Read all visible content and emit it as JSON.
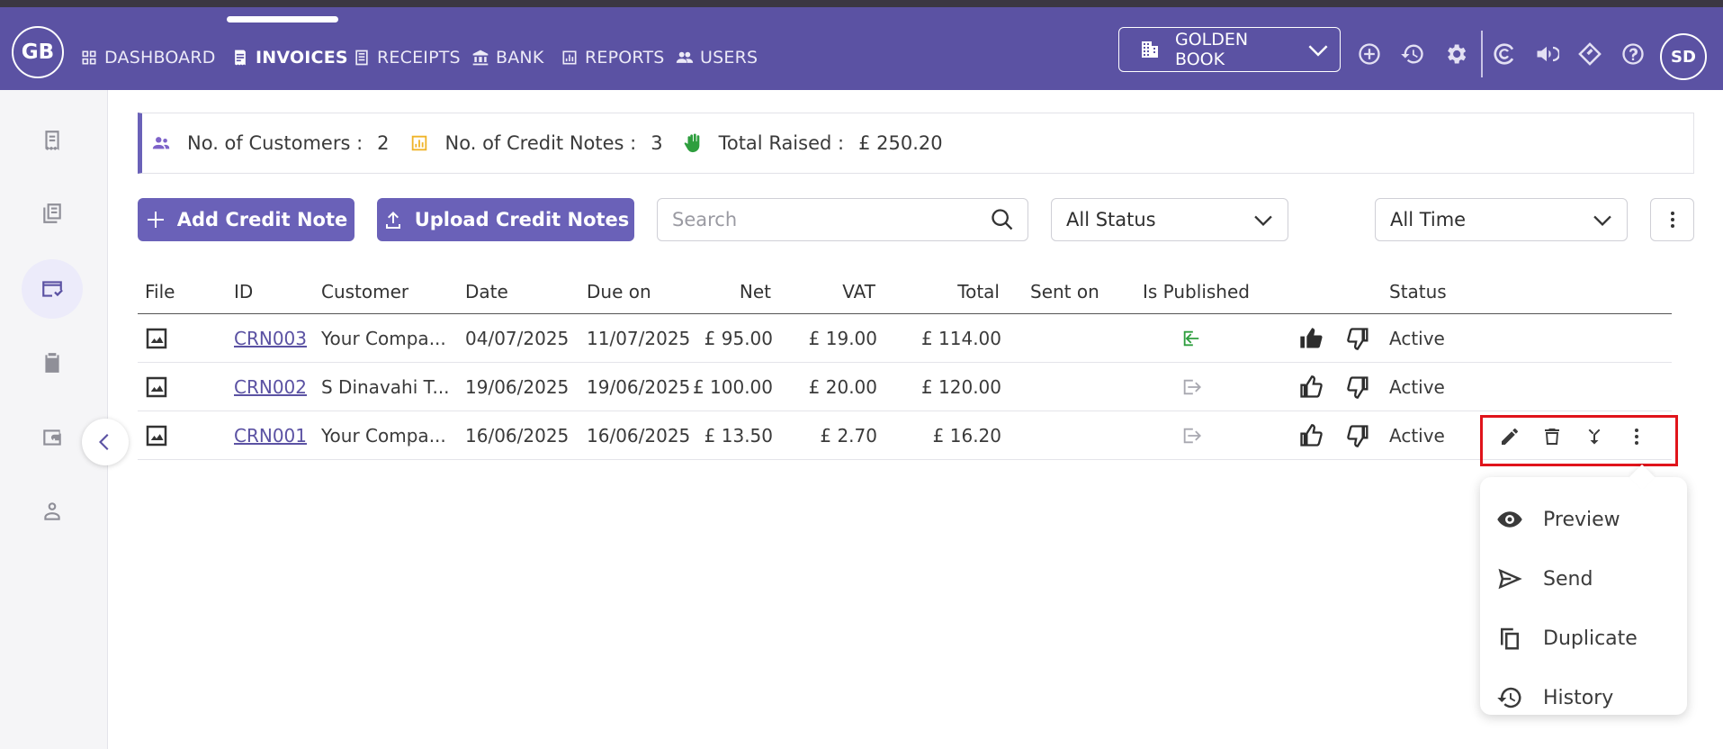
{
  "app": {
    "logo_text": "GB",
    "user_initials": "SD",
    "company": "GOLDEN BOOK"
  },
  "nav": [
    {
      "label": "DASHBOARD",
      "icon": "grid-icon"
    },
    {
      "label": "INVOICES",
      "icon": "invoice-icon",
      "active": true
    },
    {
      "label": "RECEIPTS",
      "icon": "receipt-icon"
    },
    {
      "label": "BANK",
      "icon": "bank-icon"
    },
    {
      "label": "REPORTS",
      "icon": "reports-icon"
    },
    {
      "label": "USERS",
      "icon": "users-icon"
    }
  ],
  "summary": {
    "customers_label": "No. of Customers :",
    "customers_value": "2",
    "credit_notes_label": "No. of Credit Notes :",
    "credit_notes_value": "3",
    "total_label": "Total Raised :",
    "total_value": "£ 250.20"
  },
  "toolbar": {
    "add_label": "Add Credit Note",
    "upload_label": "Upload Credit Notes",
    "search_placeholder": "Search",
    "status_filter": "All Status",
    "time_filter": "All Time"
  },
  "table": {
    "headers": {
      "file": "File",
      "id": "ID",
      "customer": "Customer",
      "date": "Date",
      "due": "Due on",
      "net": "Net",
      "vat": "VAT",
      "total": "Total",
      "sent": "Sent on",
      "published": "Is Published",
      "status": "Status"
    },
    "rows": [
      {
        "id": "CRN003",
        "customer": "Your Compa...",
        "date": "04/07/2025",
        "due": "11/07/2025",
        "net": "£ 95.00",
        "vat": "£ 19.00",
        "total": "£ 114.00",
        "sent": "",
        "published": true,
        "status": "Active"
      },
      {
        "id": "CRN002",
        "customer": "S Dinavahi T...",
        "date": "19/06/2025",
        "due": "19/06/2025",
        "net": "£ 100.00",
        "vat": "£ 20.00",
        "total": "£ 120.00",
        "sent": "",
        "published": false,
        "status": "Active"
      },
      {
        "id": "CRN001",
        "customer": "Your Compa...",
        "date": "16/06/2025",
        "due": "16/06/2025",
        "net": "£ 13.50",
        "vat": "£ 2.70",
        "total": "£ 16.20",
        "sent": "",
        "published": false,
        "status": "Active"
      }
    ]
  },
  "menu": [
    {
      "label": "Preview",
      "icon": "eye-icon"
    },
    {
      "label": "Send",
      "icon": "send-icon"
    },
    {
      "label": "Duplicate",
      "icon": "copy-icon"
    },
    {
      "label": "History",
      "icon": "history-icon"
    }
  ],
  "colors": {
    "brand": "#5b52a3",
    "button": "#6a61b8",
    "published": "#2e9e3e",
    "highlight": "#e0141b"
  }
}
